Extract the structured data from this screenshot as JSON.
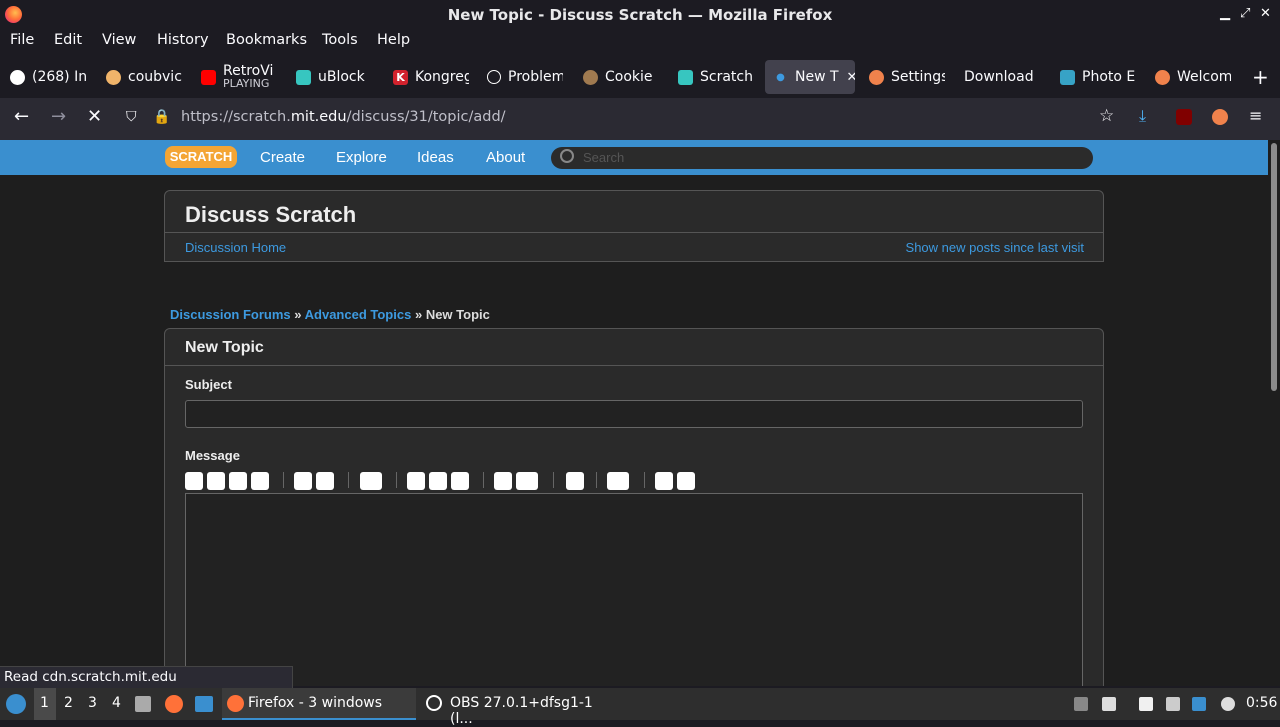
{
  "window": {
    "title": "New Topic - Discuss Scratch — Mozilla Firefox"
  },
  "menu": [
    "File",
    "Edit",
    "View",
    "History",
    "Bookmarks",
    "Tools",
    "Help"
  ],
  "tabs": [
    {
      "label": "(268) In",
      "color": "#ffffff",
      "icon": "github-icon"
    },
    {
      "label": "coubvic",
      "color": "#f0b46a",
      "icon": "cookie-icon"
    },
    {
      "label": "RetroVi",
      "sub": "PLAYING",
      "color": "#ff0000",
      "icon": "youtube-icon"
    },
    {
      "label": "uBlock",
      "color": "#37c6c0",
      "icon": "puzzle-icon"
    },
    {
      "label": "Kongreg",
      "color": "#d2222d",
      "icon": "kongregate-icon"
    },
    {
      "label": "Problem",
      "color": "#ffffff",
      "icon": "info-icon"
    },
    {
      "label": "Cookie",
      "color": "#a07a50",
      "icon": "cookie-icon"
    },
    {
      "label": "Scratch",
      "color": "#37c6c0",
      "icon": "puzzle-icon"
    },
    {
      "label": "New T",
      "color": "#3d9ae0",
      "icon": "loading-icon",
      "active": true
    },
    {
      "label": "Settings",
      "color": "#f0824c",
      "icon": "orange-icon"
    },
    {
      "label": "Download",
      "color": "#000000",
      "icon": "blank-icon"
    },
    {
      "label": "Photo E",
      "color": "#37a3c6",
      "icon": "photo-icon"
    },
    {
      "label": "Welcom",
      "color": "#f0824c",
      "icon": "orange-icon"
    }
  ],
  "nav": {
    "url_prefix": "https://scratch.",
    "url_host": "mit.edu",
    "url_path": "/discuss/31/topic/add/"
  },
  "scratch": {
    "logo": "SCRATCH",
    "nav": [
      "Create",
      "Explore",
      "Ideas",
      "About"
    ],
    "search_placeholder": "Search"
  },
  "discuss": {
    "title": "Discuss Scratch",
    "home_link": "Discussion Home",
    "new_posts_link": "Show new posts since last visit"
  },
  "breadcrumb": {
    "forums": "Discussion Forums",
    "sep": "»",
    "section": "Advanced Topics",
    "current": "New Topic"
  },
  "form": {
    "heading": "New Topic",
    "subject_label": "Subject",
    "message_label": "Message"
  },
  "status": "Read cdn.scratch.mit.edu",
  "taskbar": {
    "workspaces": [
      "1",
      "2",
      "3",
      "4"
    ],
    "firefox_task": "Firefox - 3 windows",
    "obs_task": "OBS 27.0.1+dfsg1-1 (l...",
    "clock": "0:56"
  }
}
